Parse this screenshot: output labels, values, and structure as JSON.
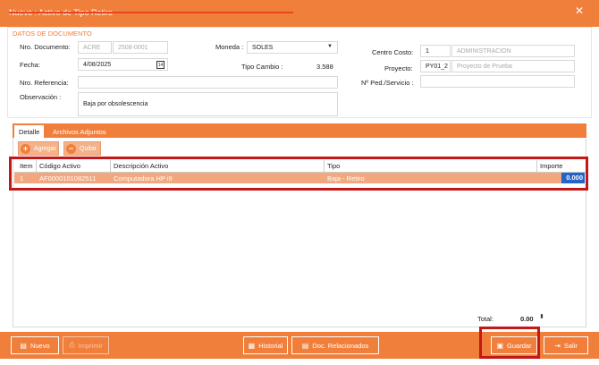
{
  "window": {
    "title": "Nuevo : Activo de Tipo Retiro",
    "close": "✕"
  },
  "section_title": "DATOS DE DOCUMENTO",
  "form": {
    "nro_documento_label": "Nro. Documento:",
    "nro_documento_serie": "ACRE",
    "nro_documento_numero": "2508-0001",
    "fecha_label": "Fecha:",
    "fecha_value": "4/08/2025",
    "nro_referencia_label": "Nro. Referencia:",
    "observacion_label": "Observación :",
    "observacion_value": "Baja por obsolescencia",
    "moneda_label": "Moneda :",
    "moneda_value": "SOLES",
    "tipo_cambio_label": "Tipo Cambio :",
    "tipo_cambio_value": "3.588",
    "centro_costo_label": "Centro Costo:",
    "centro_costo_code": "1",
    "centro_costo_name": "ADMINISTRACION",
    "proyecto_label": "Proyecto:",
    "proyecto_code": "PY01_2",
    "proyecto_name": "Proyecto de Prueba",
    "ped_servicio_label": "Nº Ped./Servicio :"
  },
  "tabs": [
    {
      "label": "Detalle"
    },
    {
      "label": "Archivos Adjuntos"
    }
  ],
  "toolbar": {
    "add_label": "Agregar",
    "remove_label": "Quitar"
  },
  "grid": {
    "columns": [
      "Item",
      "Código Activo",
      "Descripción Activo",
      "Tipo",
      "Importe"
    ],
    "rows": [
      {
        "item": "1",
        "codigo": "AF0000101082511",
        "descripcion": "Computadora HP i9",
        "tipo": "Baja -  Retiro",
        "importe": "0.000"
      }
    ]
  },
  "total": {
    "label": "Total:",
    "value": "0.00"
  },
  "footer": {
    "nuevo": "Nuevo",
    "imprimir": "Imprimir",
    "historial": "Historial",
    "doc_relacionados": "Doc. Relacionados",
    "guardar": "Guardar",
    "salir": "Salir"
  }
}
